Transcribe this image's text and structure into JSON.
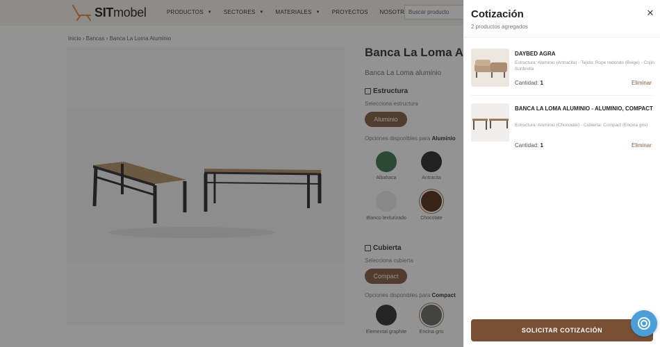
{
  "header": {
    "logo": {
      "bold": "SIT",
      "light": "mobel"
    },
    "nav": [
      {
        "label": "PRODUCTOS",
        "has_caret": true
      },
      {
        "label": "SECTORES",
        "has_caret": true
      },
      {
        "label": "MATERIALES",
        "has_caret": true
      },
      {
        "label": "PROYECTOS",
        "has_caret": false
      },
      {
        "label": "NOSOTROS",
        "has_caret": false
      }
    ],
    "search_placeholder": "Buscar producto"
  },
  "breadcrumb": "Inicio › Bancas › Banca La Loma Aluminio",
  "product": {
    "title": "Banca La Loma A",
    "subtitle": "Banca La Loma aluminio",
    "estructura": {
      "heading": "Estructura",
      "select_label": "Selecciona estructura",
      "selected": "Aluminio",
      "options_prefix": "Opciones disponibles para ",
      "options_for": "Aluminio",
      "swatches": [
        {
          "name": "Albahaca",
          "color": "#2f6a3e"
        },
        {
          "name": "Antracita",
          "color": "#1a1a1a"
        },
        {
          "name": "Blanco texturizado",
          "color": "#e9e9e9"
        },
        {
          "name": "Chocolate",
          "color": "#4a1d04"
        }
      ]
    },
    "cubierta": {
      "heading": "Cubierta",
      "select_label": "Selecciona cubierta",
      "selected": "Compact",
      "options_prefix": "Opciones disponibles para ",
      "options_for": "Compact",
      "swatches": [
        {
          "name": "Elemental graphite",
          "color": "#222222"
        },
        {
          "name": "Encina gris",
          "color": "#5e5e58"
        }
      ]
    }
  },
  "quote_panel": {
    "title": "Cotización",
    "subtitle": "2 productos agregados",
    "qty_label": "Cantidad:",
    "remove_label": "Eliminar",
    "items": [
      {
        "name": "DAYBED AGRA",
        "desc": "Estructura: Aluminio (Antracita) - Tejido: Rope redondo (Beige) - Cojín: Sunbrella",
        "qty": "1"
      },
      {
        "name": "BANCA LA LOMA ALUMINIO - ALUMINIO, COMPACT",
        "desc": "Estructura: Aluminio (Chocolate) - Cubierta: Compact (Encina gris)",
        "qty": "1"
      }
    ],
    "cta": "SOLICITAR COTIZACIÓN"
  },
  "colors": {
    "brand_brown": "#7a5035",
    "help_blue": "#4a9fd8",
    "header_bg": "#f5f0ea"
  },
  "icons": {
    "close": "close-icon",
    "help": "help-icon",
    "cube": "cube-icon",
    "layers": "cubierta-icon"
  }
}
